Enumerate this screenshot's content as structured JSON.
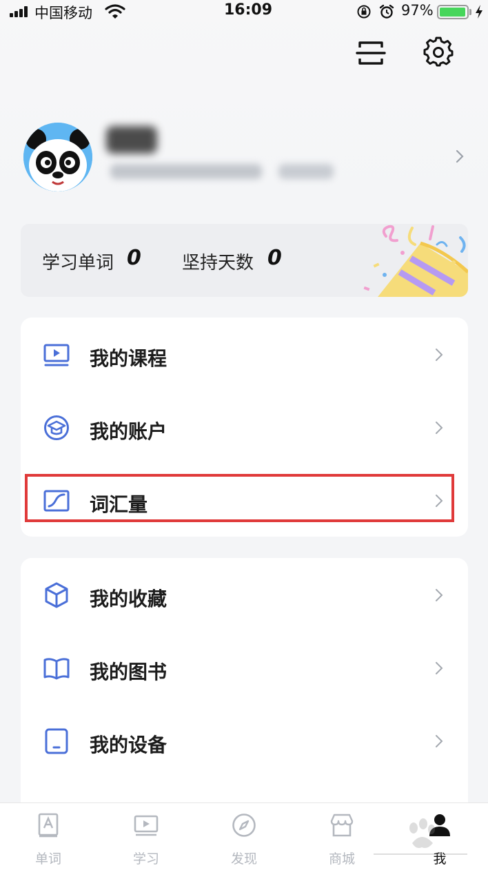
{
  "status_bar": {
    "carrier": "中国移动",
    "time": "16:09",
    "battery_percent": "97%",
    "battery_level": 0.97
  },
  "header": {
    "icons": [
      "scan-icon",
      "gear-icon"
    ]
  },
  "stats": {
    "words_label": "学习单词",
    "words_value": "0",
    "days_label": "坚持天数",
    "days_value": "0"
  },
  "menu_group_1": [
    {
      "label": "我的课程",
      "icon": "play-screen-icon"
    },
    {
      "label": "我的账户",
      "icon": "graduation-cap-icon"
    },
    {
      "label": "词汇量",
      "icon": "trend-chart-icon"
    }
  ],
  "menu_group_2": [
    {
      "label": "我的收藏",
      "icon": "cube-icon"
    },
    {
      "label": "我的图书",
      "icon": "book-icon"
    },
    {
      "label": "我的设备",
      "icon": "tablet-icon"
    }
  ],
  "tab_bar": {
    "tabs": [
      {
        "label": "单词",
        "icon": "vocab-card-icon"
      },
      {
        "label": "学习",
        "icon": "play-screen-icon"
      },
      {
        "label": "发现",
        "icon": "compass-icon"
      },
      {
        "label": "商城",
        "icon": "store-icon"
      },
      {
        "label": "我",
        "icon": "person-icon"
      }
    ],
    "active": "我"
  },
  "colors": {
    "accent": "#4a6fd8",
    "highlight": "#e03a3a",
    "battery": "#47d65b"
  }
}
